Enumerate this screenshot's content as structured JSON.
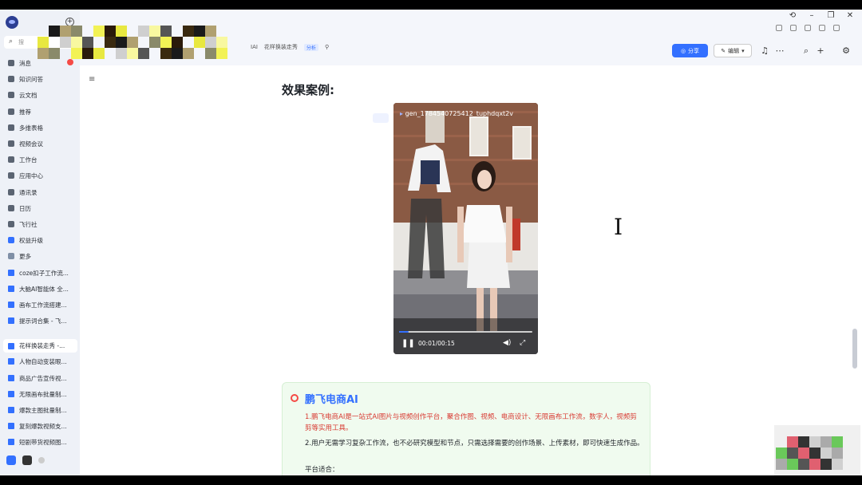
{
  "sidebar": {
    "search_label": "搜",
    "items": [
      {
        "label": "消息"
      },
      {
        "label": "知识问答"
      },
      {
        "label": "云文档"
      },
      {
        "label": "推荐"
      },
      {
        "label": "多维表格"
      },
      {
        "label": "视频会议"
      },
      {
        "label": "工作台"
      },
      {
        "label": "应用中心"
      },
      {
        "label": "通讯录"
      },
      {
        "label": "日历"
      },
      {
        "label": "飞行社"
      },
      {
        "label": "权益升级"
      },
      {
        "label": "更多"
      }
    ],
    "docs_top": [
      {
        "label": "coze扣子工作流..."
      },
      {
        "label": "大脑AI智能体 全..."
      },
      {
        "label": "画布工作流搭建..."
      },
      {
        "label": "提示词合集 - 飞..."
      }
    ],
    "docs_bottom": [
      {
        "label": "花样换装走秀 -..."
      },
      {
        "label": "人物自动变装眼..."
      },
      {
        "label": "商品广告宣传视..."
      },
      {
        "label": "无限画布批量制..."
      },
      {
        "label": "爆款主图批量制..."
      },
      {
        "label": "复刻爆款视频支..."
      },
      {
        "label": "短剧带货视频图..."
      }
    ]
  },
  "header": {
    "breadcrumb_parent": "IAI",
    "doc_title": "花样换装走秀",
    "tag": "分析",
    "share_label": "分享",
    "edit_label": "编辑"
  },
  "document": {
    "section_title": "效果案例:",
    "video": {
      "title": "gen_1784540725412_tuphdqxt2v",
      "current_time": "00:01",
      "separator": "/",
      "duration": "00:15",
      "progress": 0.07
    },
    "card": {
      "title": "鹏飞电商AI",
      "para1": "1.鹏飞电商AI是一站式AI图片与视频创作平台，聚合作图、视频、电商设计、无限画布工作流，数字人，视频剪剪等实用工具。",
      "para2": "2.用户无需学习复杂工作流，也不必研究模型和节点，只需选择需要的创作场景、上传素材，即可快速生成作品。",
      "para3": "平台适合："
    }
  },
  "colors": {
    "accent": "#3370ff",
    "card_bg": "#f0fbef",
    "alert_text": "#d83931"
  }
}
